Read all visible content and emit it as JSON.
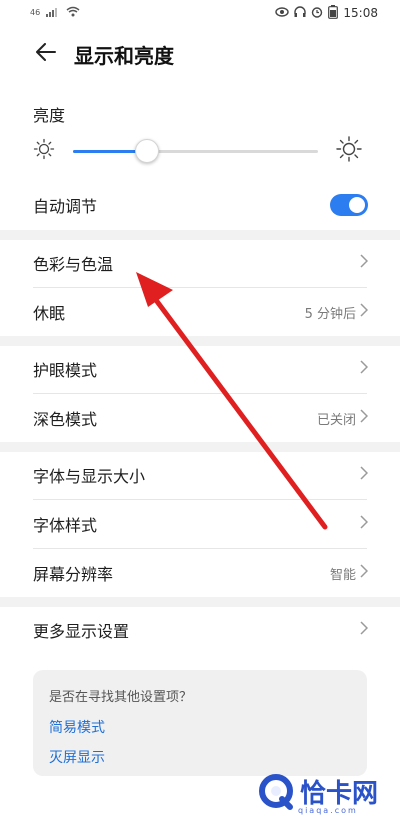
{
  "status_bar": {
    "signal_text": "46",
    "time": "15:08",
    "icons": [
      "signal-icon",
      "wifi-icon",
      "eye-icon",
      "headphones-icon",
      "alarm-icon",
      "battery-icon"
    ]
  },
  "header": {
    "title": "显示和亮度",
    "back_icon": "back-arrow-icon"
  },
  "brightness": {
    "label": "亮度",
    "level": 0.3,
    "accent_color": "#2c7df0"
  },
  "auto_adjust": {
    "label": "自动调节",
    "enabled": true
  },
  "groups": [
    {
      "rows": [
        {
          "label": "色彩与色温",
          "value": ""
        },
        {
          "label": "休眠",
          "value": "5 分钟后"
        }
      ]
    },
    {
      "rows": [
        {
          "label": "护眼模式",
          "value": ""
        },
        {
          "label": "深色模式",
          "value": "已关闭"
        }
      ]
    },
    {
      "rows": [
        {
          "label": "字体与显示大小",
          "value": ""
        },
        {
          "label": "字体样式",
          "value": ""
        },
        {
          "label": "屏幕分辨率",
          "value": "智能"
        }
      ]
    },
    {
      "rows": [
        {
          "label": "更多显示设置",
          "value": ""
        }
      ]
    }
  ],
  "suggestion": {
    "question": "是否在寻找其他设置项？",
    "links": [
      "简易模式",
      "灭屏显示"
    ]
  },
  "watermark": {
    "text": "恰卡网",
    "domain": "qiaqa.com"
  }
}
